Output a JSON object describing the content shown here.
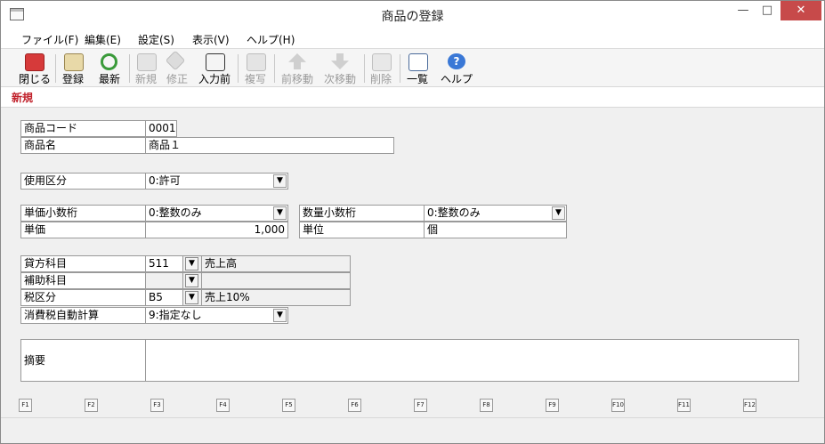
{
  "window": {
    "title": "商品の登録",
    "min_glyph": "—",
    "max_glyph": "□",
    "close_glyph": "✕"
  },
  "menu": [
    "ファイル(F)",
    "編集(E)",
    "設定(S)",
    "表示(V)",
    "ヘルプ(H)"
  ],
  "toolbar": {
    "close": "閉じる",
    "register": "登録",
    "refresh": "最新",
    "new": "新規",
    "modify": "修正",
    "before_input": "入力前",
    "copy": "複写",
    "prev": "前移動",
    "next": "次移動",
    "delete": "削除",
    "list": "一覧",
    "help": "ヘルプ"
  },
  "mode_tab": "新規",
  "form": {
    "code_label": "商品コード",
    "code_value": "0001",
    "name_label": "商品名",
    "name_value": "商品１",
    "usage_label": "使用区分",
    "usage_value": "0:許可",
    "price_decimal_label": "単価小数桁",
    "price_decimal_value": "0:整数のみ",
    "qty_decimal_label": "数量小数桁",
    "qty_decimal_value": "0:整数のみ",
    "unit_price_label": "単価",
    "unit_price_value": "1,000",
    "unit_label": "単位",
    "unit_value": "個",
    "credit_label": "貸方科目",
    "credit_code": "511",
    "credit_name": "売上高",
    "sub_label": "補助科目",
    "sub_code": "",
    "sub_name": "",
    "tax_label": "税区分",
    "tax_code": "B5",
    "tax_name": "売上10%",
    "auto_tax_label": "消費税自動計算",
    "auto_tax_value": "9:指定なし",
    "memo_label": "摘要",
    "memo_value": ""
  },
  "fkeys": [
    "F1",
    "F2",
    "F3",
    "F4",
    "F5",
    "F6",
    "F7",
    "F8",
    "F9",
    "F10",
    "F11",
    "F12"
  ]
}
